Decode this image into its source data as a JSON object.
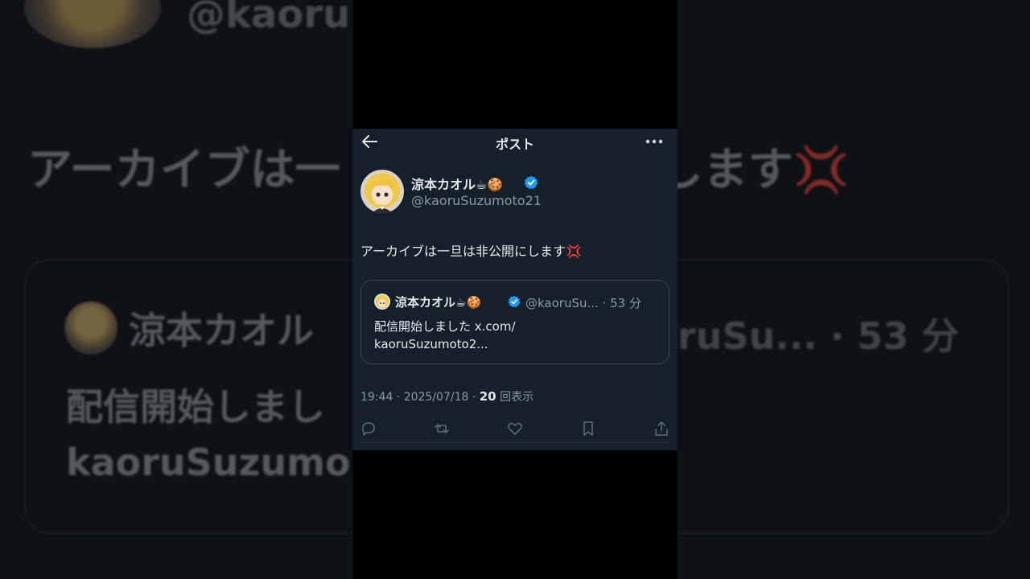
{
  "background": {
    "handle": "@kaoru",
    "text": "アーカイブは一",
    "text_tail": "します",
    "card_name": "涼本カオル",
    "card_meta": "ruSu... · 53 分",
    "card_line1": "配信開始しまし",
    "card_line2": "kaoruSuzumo"
  },
  "header": {
    "title": "ポスト"
  },
  "post": {
    "author_name": "涼本カオル☕🍪",
    "author_handle": "@kaoruSuzumoto21",
    "text": "アーカイブは一旦は非公開にします",
    "text_emoji": "💢",
    "quote": {
      "name": "涼本カオル☕🍪",
      "meta": "@kaoruSu... · 53 分",
      "line1": "配信開始しました x.com/",
      "line2": "kaoruSuzumoto2..."
    },
    "timestamp": "19:44 · 2025/07/18 · ",
    "views_count": "20",
    "views_label": " 回表示"
  },
  "colors": {
    "background": "#15202b",
    "text": "#e7e9ea",
    "muted": "#8b98a5",
    "verified": "#1d9bf0",
    "border": "#38444d"
  },
  "icons": [
    "back-arrow-icon",
    "more-icon",
    "verified-badge-icon",
    "reply-icon",
    "repost-icon",
    "like-icon",
    "bookmark-icon",
    "share-icon"
  ]
}
